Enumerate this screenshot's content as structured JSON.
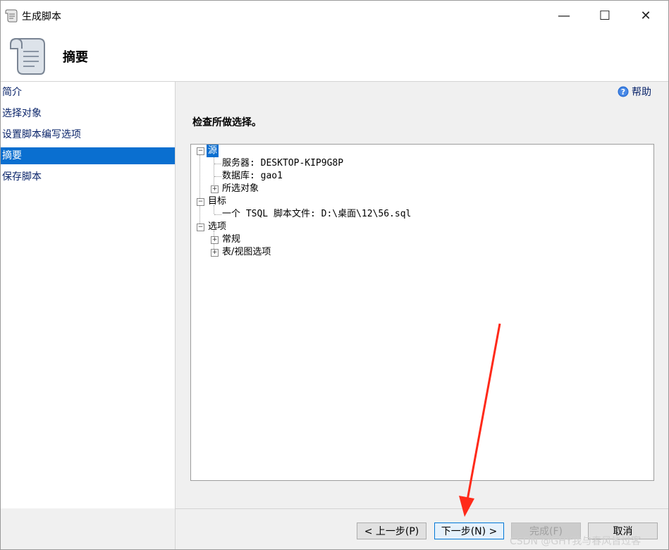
{
  "window": {
    "title": "生成脚本",
    "minimize": "—",
    "maximize": "☐",
    "close": "✕"
  },
  "header": {
    "title": "摘要",
    "icon": "scroll-icon"
  },
  "sidebar": {
    "items": [
      {
        "label": "简介"
      },
      {
        "label": "选择对象"
      },
      {
        "label": "设置脚本编写选项"
      },
      {
        "label": "摘要",
        "selected": true
      },
      {
        "label": "保存脚本"
      }
    ]
  },
  "main": {
    "help_label": "帮助",
    "check_label": "检查所做选择。"
  },
  "tree": {
    "source": "源",
    "server": "服务器: DESKTOP-KIP9G8P",
    "database": "数据库: gao1",
    "selected_objects": "所选对象",
    "target": "目标",
    "target_file": "一个 TSQL 脚本文件: D:\\桌面\\12\\56.sql",
    "options": "选项",
    "general": "常规",
    "table_view_options": "表/视图选项",
    "expanded_glyph": "−",
    "collapsed_glyph": "+"
  },
  "footer": {
    "back": "< 上一步(P)",
    "next": "下一步(N) >",
    "finish": "完成(F)",
    "cancel": "取消"
  },
  "watermark": "CSDN @GHY我与春风皆过客",
  "colors": {
    "selection": "#0a6fd0",
    "link": "#0a246a",
    "panel": "#f0f0f0",
    "arrow": "#ff2a1a"
  }
}
